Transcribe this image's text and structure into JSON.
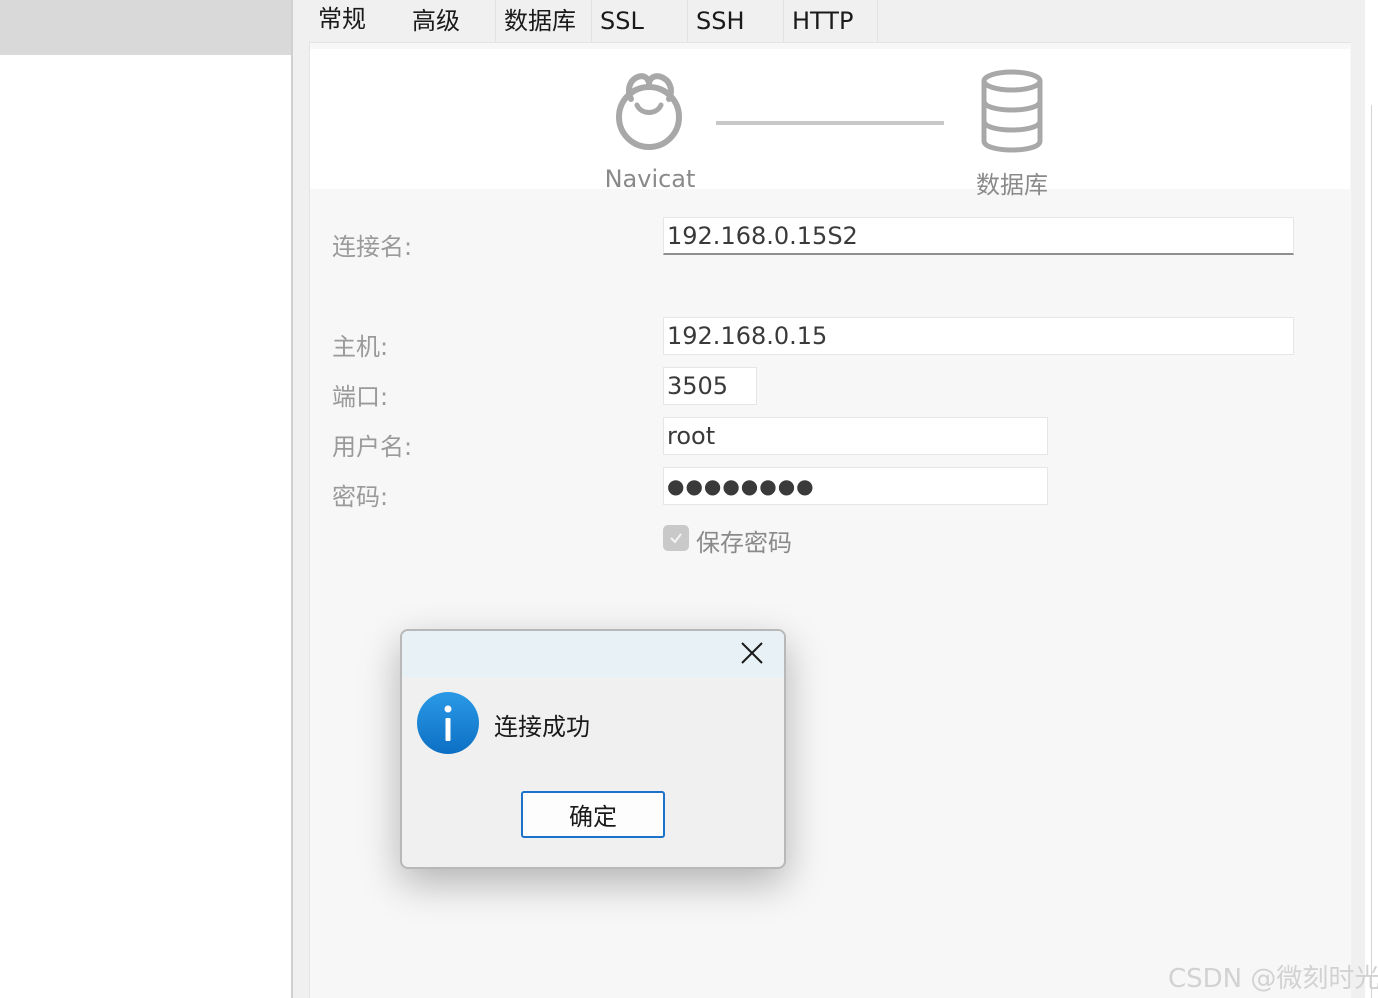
{
  "tabs": [
    {
      "label": "常规"
    },
    {
      "label": "高级"
    },
    {
      "label": "数据库"
    },
    {
      "label": "SSL"
    },
    {
      "label": "SSH"
    },
    {
      "label": "HTTP"
    }
  ],
  "diagram": {
    "left_label": "Navicat",
    "right_label": "数据库"
  },
  "form": {
    "connection_name_label": "连接名:",
    "connection_name_value": "192.168.0.15S2",
    "host_label": "主机:",
    "host_value": "192.168.0.15",
    "port_label": "端口:",
    "port_value": "3505",
    "username_label": "用户名:",
    "username_value": "root",
    "password_label": "密码:",
    "password_value": "●●●●●●●●",
    "save_password_label": "保存密码",
    "save_password_checked": true
  },
  "dialog": {
    "message": "连接成功",
    "ok_label": "确定",
    "icon": "info-icon"
  },
  "watermark": "CSDN @微刻时光",
  "colors": {
    "dialog_button_border": "#1a73c8",
    "info_icon": "#1a86d8"
  }
}
